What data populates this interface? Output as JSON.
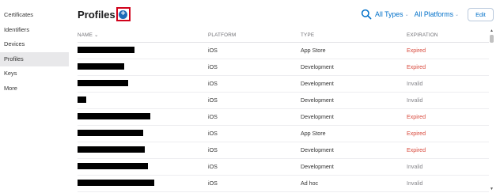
{
  "sidebar": {
    "items": [
      {
        "label": "Certificates",
        "active": false
      },
      {
        "label": "Identifiers",
        "active": false
      },
      {
        "label": "Devices",
        "active": false
      },
      {
        "label": "Profiles",
        "active": true
      },
      {
        "label": "Keys",
        "active": false
      },
      {
        "label": "More",
        "active": false
      }
    ]
  },
  "header": {
    "title": "Profiles",
    "add_icon": "plus-circle-icon",
    "filters": [
      {
        "label": "All Types",
        "icon": "chevron-down-icon"
      },
      {
        "label": "All Platforms",
        "icon": "chevron-down-icon"
      }
    ],
    "edit_label": "Edit",
    "search_icon": "search-icon"
  },
  "table": {
    "columns": [
      "NAME",
      "PLATFORM",
      "TYPE",
      "EXPIRATION"
    ],
    "sort_indicator": "⌄",
    "rows": [
      {
        "name": "[redacted]",
        "platform": "iOS",
        "type": "App Store",
        "expiration": "Expired"
      },
      {
        "name": "[redacted]",
        "platform": "iOS",
        "type": "Development",
        "expiration": "Expired"
      },
      {
        "name": "[redacted]",
        "platform": "iOS",
        "type": "Development",
        "expiration": "Invalid"
      },
      {
        "name": "[redacted]",
        "platform": "iOS",
        "type": "Development",
        "expiration": "Invalid"
      },
      {
        "name": "[redacted]",
        "platform": "iOS",
        "type": "Development",
        "expiration": "Expired"
      },
      {
        "name": "[redacted]",
        "platform": "iOS",
        "type": "App Store",
        "expiration": "Expired"
      },
      {
        "name": "[redacted]",
        "platform": "iOS",
        "type": "Development",
        "expiration": "Expired"
      },
      {
        "name": "[redacted]",
        "platform": "iOS",
        "type": "Development",
        "expiration": "Invalid"
      },
      {
        "name": "[redacted]",
        "platform": "iOS",
        "type": "Ad hoc",
        "expiration": "Invalid"
      }
    ]
  },
  "colors": {
    "accent": "#0070c9",
    "expired": "#d8483b",
    "invalid": "#86868b",
    "highlight_box": "#d0021b"
  }
}
